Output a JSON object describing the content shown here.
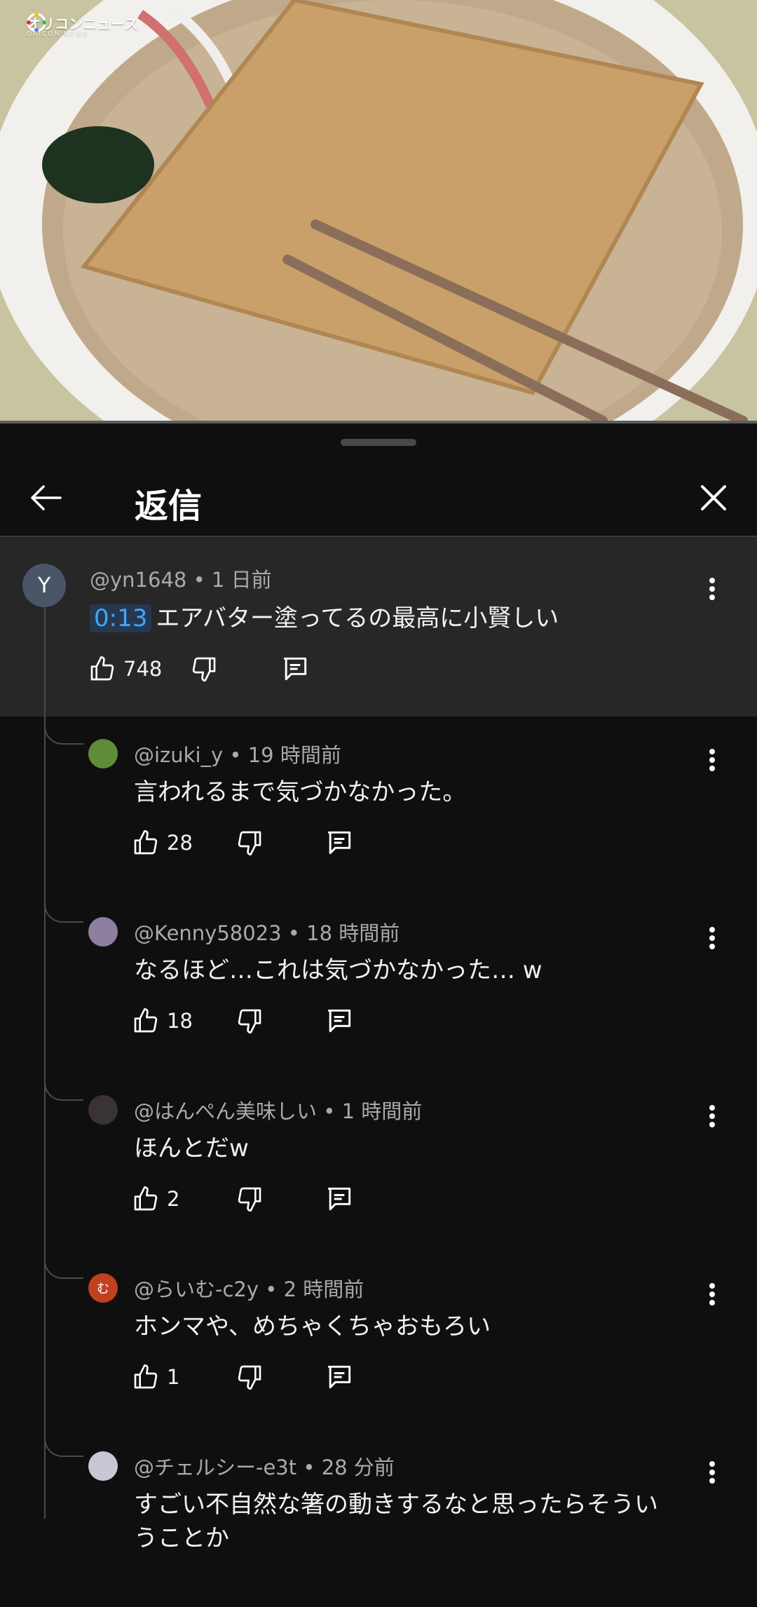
{
  "video": {
    "watermark_main": "オリコンニュース",
    "watermark_sub": "ORICON NEWS",
    "progress_fraction": 0.0
  },
  "header": {
    "title": "返信",
    "back_icon": "arrow-left-icon",
    "close_icon": "close-icon"
  },
  "parent_comment": {
    "avatar_letter": "Y",
    "avatar_color": "#4a5568",
    "author": "@yn1648",
    "time": "1 日前",
    "timestamp": "0:13",
    "text": "エアバター塗ってるの最高に小賢しい",
    "likes": "748"
  },
  "replies": [
    {
      "author": "@izuki_y",
      "time": "19 時間前",
      "text": "言われるまで気づかなかった。",
      "likes": "28",
      "avatar_color": "#5f8c3a"
    },
    {
      "author": "@Kenny58023",
      "time": "18 時間前",
      "text": "なるほど…これは気づかなかった… w",
      "likes": "18",
      "avatar_color": "#8d7fa0"
    },
    {
      "author": "@はんぺん美味しい",
      "time": "1 時間前",
      "text": "ほんとだw",
      "likes": "2",
      "avatar_color": "#3a3336"
    },
    {
      "author": "@らいむ-c2y",
      "time": "2 時間前",
      "text": "ホンマや、めちゃくちゃおもろい",
      "likes": "1",
      "avatar_color": "#c0401f",
      "avatar_letter": "む"
    },
    {
      "author": "@チェルシー-e3t",
      "time": "28 分前",
      "text": "すごい不自然な箸の動きするなと思ったらそうい",
      "text2": "うことか",
      "likes": "",
      "avatar_color": "#c9c6d6"
    }
  ]
}
